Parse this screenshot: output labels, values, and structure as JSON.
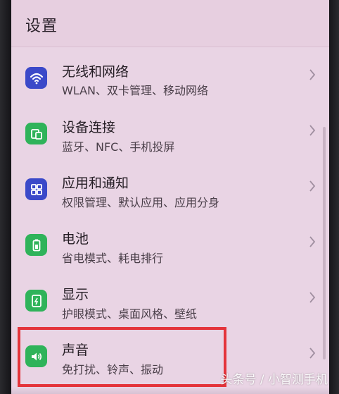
{
  "header": {
    "title": "设置"
  },
  "items": [
    {
      "title": "无线和网络",
      "subtitle": "WLAN、双卡管理、移动网络",
      "icon": "wifi-icon",
      "icon_color": "#3b49c9"
    },
    {
      "title": "设备连接",
      "subtitle": "蓝牙、NFC、手机投屏",
      "icon": "device-connect-icon",
      "icon_color": "#2fb35a"
    },
    {
      "title": "应用和通知",
      "subtitle": "权限管理、默认应用、应用分身",
      "icon": "apps-icon",
      "icon_color": "#3b49c9"
    },
    {
      "title": "电池",
      "subtitle": "省电模式、耗电排行",
      "icon": "battery-icon",
      "icon_color": "#2fb35a"
    },
    {
      "title": "显示",
      "subtitle": "护眼模式、桌面风格、壁纸",
      "icon": "display-icon",
      "icon_color": "#2fb35a"
    },
    {
      "title": "声音",
      "subtitle": "免打扰、铃声、振动",
      "icon": "sound-icon",
      "icon_color": "#2fb35a"
    }
  ],
  "annotation": {
    "highlight_color": "#e4343b"
  },
  "watermark": "头条号 / 小智测手机"
}
